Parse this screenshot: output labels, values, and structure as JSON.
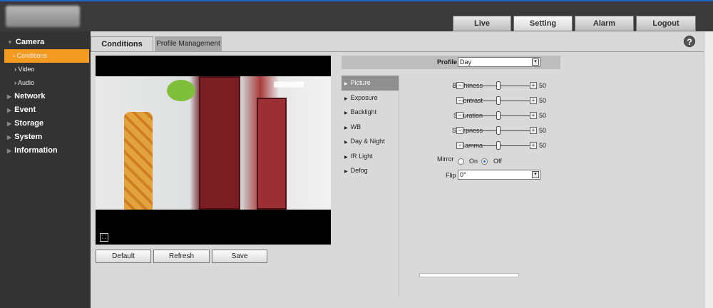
{
  "nav": {
    "tabs": [
      "Live",
      "Setting",
      "Alarm",
      "Logout"
    ],
    "active": "Setting"
  },
  "sidebar": {
    "sections": [
      {
        "label": "Camera",
        "expanded": true,
        "items": [
          "Conditions",
          "Video",
          "Audio"
        ],
        "active_item": "Conditions"
      },
      {
        "label": "Network"
      },
      {
        "label": "Event"
      },
      {
        "label": "Storage"
      },
      {
        "label": "System"
      },
      {
        "label": "Information"
      }
    ]
  },
  "main": {
    "tabs": [
      "Conditions",
      "Profile Management"
    ],
    "active_tab": "Conditions",
    "help_icon": "?",
    "profile": {
      "label": "Profile",
      "value": "Day"
    },
    "categories": [
      "Picture",
      "Exposure",
      "Backlight",
      "WB",
      "Day & Night",
      "IR Light",
      "Defog"
    ],
    "active_category": "Picture",
    "sliders": [
      {
        "label": "Brightness",
        "value": "50"
      },
      {
        "label": "Contrast",
        "value": "50"
      },
      {
        "label": "Saturation",
        "value": "50"
      },
      {
        "label": "Sharpness",
        "value": "50"
      },
      {
        "label": "Gamma",
        "value": "50"
      }
    ],
    "mirror": {
      "label": "Mirror",
      "on_label": "On",
      "off_label": "Off",
      "selected": "Off"
    },
    "flip": {
      "label": "Flip",
      "value": "0°"
    },
    "buttons": {
      "default": "Default",
      "refresh": "Refresh",
      "save": "Save"
    }
  },
  "colors": {
    "accent": "#f39a21",
    "brand": "#1e64c8",
    "sidebar_bg": "#333333",
    "panel_bg": "#d9d9d9"
  }
}
